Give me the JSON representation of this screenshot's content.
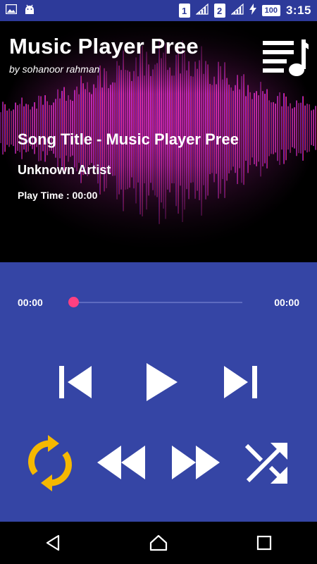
{
  "status_bar": {
    "sim1": "1",
    "sim2": "2",
    "battery": "100",
    "time": "3:15"
  },
  "header": {
    "title": "Music Player Pree",
    "author": "by sohanoor rahman"
  },
  "now_playing": {
    "song_title": "Song Title - Music Player Pree",
    "artist": "Unknown Artist",
    "play_time": "Play Time : 00:00"
  },
  "progress": {
    "current": "00:00",
    "total": "00:00",
    "fraction": 0
  },
  "controls": {
    "previous": "skip-previous-icon",
    "play": "play-icon",
    "next": "skip-next-icon",
    "repeat": "repeat-icon",
    "rewind": "rewind-icon",
    "fast_forward": "fast-forward-icon",
    "shuffle": "shuffle-icon"
  },
  "colors": {
    "controls_bg": "#3545a5",
    "status_bar": "#2d3a9a",
    "accent": "#ff4081",
    "repeat_active": "#f5b800"
  },
  "nav": [
    "back-icon",
    "home-icon",
    "recents-icon"
  ]
}
